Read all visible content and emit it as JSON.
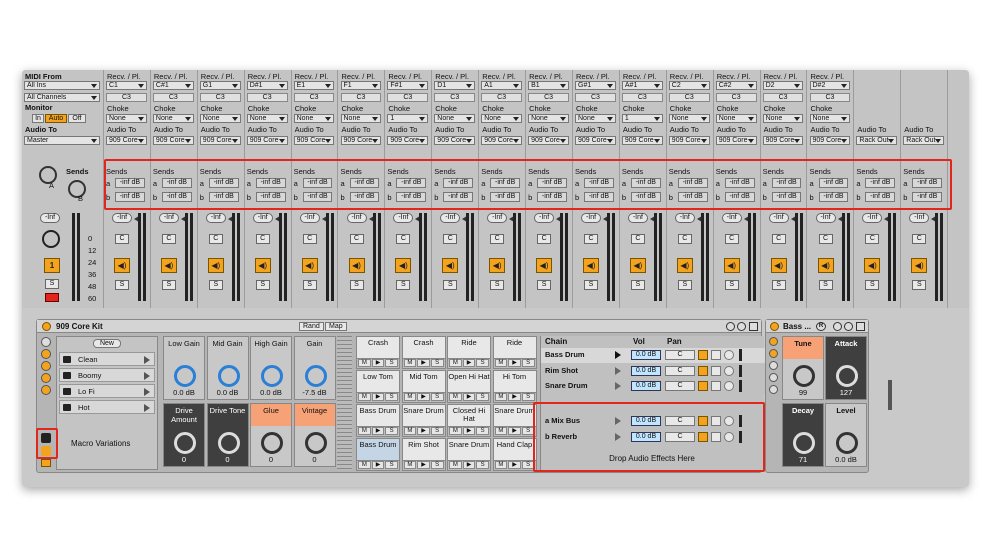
{
  "master": {
    "midi_from": "MIDI From",
    "all_ins": "All Ins",
    "all_channels": "All Channels",
    "monitor": "Monitor",
    "mon_in": "In",
    "mon_auto": "Auto",
    "mon_off": "Off",
    "audio_to": "Audio To",
    "audio_to_val": "Master",
    "sends": "Sends",
    "knob_a": "A",
    "knob_b": "B",
    "vol_val": "-Inf",
    "track_num": "1",
    "solo": "S",
    "scale": [
      "0",
      "12",
      "24",
      "36",
      "48",
      "60"
    ]
  },
  "pads_columns": [
    {
      "recv": "Recv. / Pl.",
      "note": "C1",
      "out": "C3",
      "choke": "Choke",
      "choke_val": "None",
      "audio_to": "Audio To",
      "audio_to_val": "909 Core"
    },
    {
      "recv": "Recv. / Pl.",
      "note": "C#1",
      "out": "C3",
      "choke": "Choke",
      "choke_val": "None",
      "audio_to": "Audio To",
      "audio_to_val": "909 Core"
    },
    {
      "recv": "Recv. / Pl.",
      "note": "G1",
      "out": "C3",
      "choke": "Choke",
      "choke_val": "None",
      "audio_to": "Audio To",
      "audio_to_val": "909 Core"
    },
    {
      "recv": "Recv. / Pl.",
      "note": "D#1",
      "out": "C3",
      "choke": "Choke",
      "choke_val": "None",
      "audio_to": "Audio To",
      "audio_to_val": "909 Core"
    },
    {
      "recv": "Recv. / Pl.",
      "note": "E1",
      "out": "C3",
      "choke": "Choke",
      "choke_val": "None",
      "audio_to": "Audio To",
      "audio_to_val": "909 Core"
    },
    {
      "recv": "Recv. / Pl.",
      "note": "F1",
      "out": "C3",
      "choke": "Choke",
      "choke_val": "None",
      "audio_to": "Audio To",
      "audio_to_val": "909 Core"
    },
    {
      "recv": "Recv. / Pl.",
      "note": "F#1",
      "out": "C3",
      "choke": "Choke",
      "choke_val": "1",
      "audio_to": "Audio To",
      "audio_to_val": "909 Core"
    },
    {
      "recv": "Recv. / Pl.",
      "note": "D1",
      "out": "C3",
      "choke": "Choke",
      "choke_val": "None",
      "audio_to": "Audio To",
      "audio_to_val": "909 Core"
    },
    {
      "recv": "Recv. / Pl.",
      "note": "A1",
      "out": "C3",
      "choke": "Choke",
      "choke_val": "None",
      "audio_to": "Audio To",
      "audio_to_val": "909 Core"
    },
    {
      "recv": "Recv. / Pl.",
      "note": "B1",
      "out": "C3",
      "choke": "Choke",
      "choke_val": "None",
      "audio_to": "Audio To",
      "audio_to_val": "909 Core"
    },
    {
      "recv": "Recv. / Pl.",
      "note": "G#1",
      "out": "C3",
      "choke": "Choke",
      "choke_val": "None",
      "audio_to": "Audio To",
      "audio_to_val": "909 Core"
    },
    {
      "recv": "Recv. / Pl.",
      "note": "A#1",
      "out": "C3",
      "choke": "Choke",
      "choke_val": "1",
      "audio_to": "Audio To",
      "audio_to_val": "909 Core"
    },
    {
      "recv": "Recv. / Pl.",
      "note": "C2",
      "out": "C3",
      "choke": "Choke",
      "choke_val": "None",
      "audio_to": "Audio To",
      "audio_to_val": "909 Core"
    },
    {
      "recv": "Recv. / Pl.",
      "note": "C#2",
      "out": "C3",
      "choke": "Choke",
      "choke_val": "None",
      "audio_to": "Audio To",
      "audio_to_val": "909 Core"
    },
    {
      "recv": "Recv. / Pl.",
      "note": "D2",
      "out": "C3",
      "choke": "Choke",
      "choke_val": "None",
      "audio_to": "Audio To",
      "audio_to_val": "909 Core"
    },
    {
      "recv": "Recv. / Pl.",
      "note": "D#2",
      "out": "C3",
      "choke": "Choke",
      "choke_val": "None",
      "audio_to": "Audio To",
      "audio_to_val": "909 Core"
    }
  ],
  "return_columns": [
    {
      "audio_to": "Audio To",
      "audio_to_val": "Rack Out"
    },
    {
      "audio_to": "Audio To",
      "audio_to_val": "Rack Out"
    }
  ],
  "strip": {
    "sends": "Sends",
    "a": "a",
    "b": "b",
    "send_val": "-inf dB",
    "vol": "-Inf",
    "cue": "C",
    "speaker": "◀)",
    "solo": "S"
  },
  "rack": {
    "title": "909 Core Kit",
    "rand": "Rand",
    "map": "Map",
    "new": "New",
    "variations": [
      "Clean",
      "Boomy",
      "Lo Fi",
      "Hot"
    ],
    "macro_variations": "Macro Variations",
    "macros": [
      {
        "label": "Low Gain",
        "value": "0.0 dB",
        "style": "plain"
      },
      {
        "label": "Mid Gain",
        "value": "0.0 dB",
        "style": "plain"
      },
      {
        "label": "High Gain",
        "value": "0.0 dB",
        "style": "plain"
      },
      {
        "label": "Gain",
        "value": "-7.5 dB",
        "style": "plain"
      },
      {
        "label": "Drive Amount",
        "value": "0",
        "style": "dark"
      },
      {
        "label": "Drive Tone",
        "value": "0",
        "style": "dark"
      },
      {
        "label": "Glue",
        "value": "0",
        "style": "orange"
      },
      {
        "label": "Vintage",
        "value": "0",
        "style": "orange"
      }
    ],
    "pads": [
      {
        "name": "Crash"
      },
      {
        "name": "Crash"
      },
      {
        "name": "Ride"
      },
      {
        "name": "Ride"
      },
      {
        "name": "Low Tom"
      },
      {
        "name": "Mid Tom"
      },
      {
        "name": "Open Hi Hat"
      },
      {
        "name": "Hi Tom"
      },
      {
        "name": "Bass Drum"
      },
      {
        "name": "Snare Drum"
      },
      {
        "name": "Closed Hi Hat"
      },
      {
        "name": "Snare Drum"
      },
      {
        "name": "Bass Drum"
      },
      {
        "name": "Rim Shot"
      },
      {
        "name": "Snare Drum"
      },
      {
        "name": "Hand Clap"
      }
    ],
    "pad_btns": [
      "M",
      "▶",
      "S"
    ],
    "chain_header": "Chain",
    "vol_header": "Vol",
    "pan_header": "Pan",
    "chains": [
      {
        "name": "Bass Drum",
        "vol": "0.0 dB",
        "pan": "C"
      },
      {
        "name": "Rim Shot",
        "vol": "0.0 dB",
        "pan": "C"
      },
      {
        "name": "Snare Drum",
        "vol": "0.0 dB",
        "pan": "C"
      }
    ],
    "returns": [
      {
        "name": "a Mix Bus",
        "vol": "0.0 dB",
        "pan": "C"
      },
      {
        "name": "b Reverb",
        "vol": "0.0 dB",
        "pan": "C"
      }
    ],
    "drop_text": "Drop Audio Effects Here"
  },
  "bass_device": {
    "title": "Bass ...",
    "r": "R",
    "knobs": [
      {
        "label": "Tune",
        "value": "99",
        "style": "orange"
      },
      {
        "label": "Attack",
        "value": "127",
        "style": "dark"
      },
      {
        "label": "Decay",
        "value": "71",
        "style": "dark"
      },
      {
        "label": "Level",
        "value": "0.0 dB",
        "style": "plain"
      }
    ]
  },
  "colors": {
    "accent": "#f4a31f",
    "highlight_red": "#e2261c",
    "vol_blue": "#bfe5ff",
    "orange_label": "#f7a276"
  }
}
